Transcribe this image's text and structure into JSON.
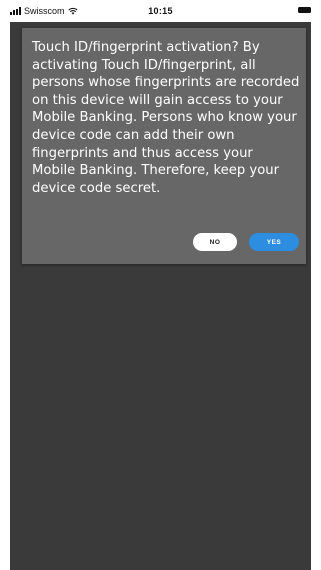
{
  "status_bar": {
    "carrier": "Swisscom",
    "time": "10:15"
  },
  "dialog": {
    "message": "Touch ID/fingerprint activation? By activating Touch ID/fingerprint, all persons whose fingerprints are recorded on this device will gain access to your Mobile Banking. Persons who know your device code can add their own fingerprints and thus access your Mobile Banking. Therefore, keep your device code secret.",
    "no_label": "NO",
    "yes_label": "YES"
  },
  "colors": {
    "screen_background": "#3a3a3a",
    "dialog_background": "#676767",
    "yes_button": "#2d8de0",
    "no_button": "#ffffff"
  }
}
